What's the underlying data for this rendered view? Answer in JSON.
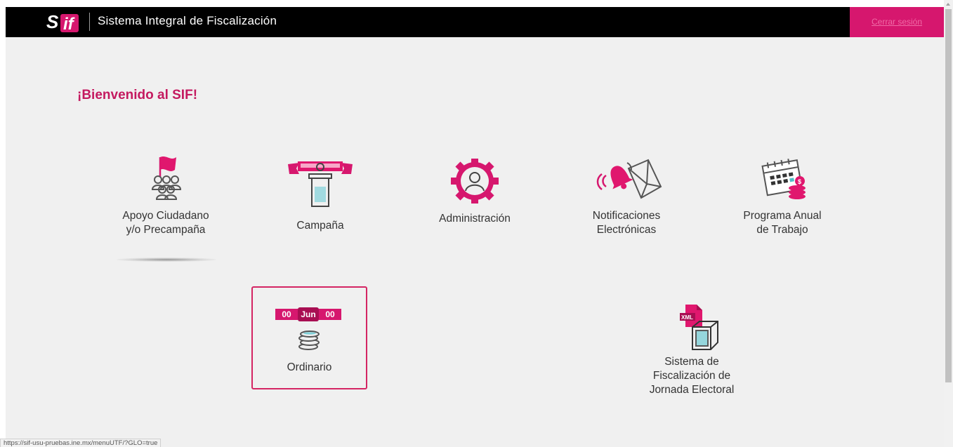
{
  "header": {
    "logo_text": "Sif",
    "title": "Sistema Integral de Fiscalización",
    "logout_label": "Cerrar sesión",
    "brand_color": "#d6176e"
  },
  "welcome": "¡Bienvenido al SIF!",
  "modules": {
    "apoyo": {
      "label_line1": "Apoyo Ciudadano",
      "label_line2": "y/o Precampaña",
      "icon": "flag-people-icon"
    },
    "campana": {
      "label": "Campaña",
      "icon": "podium-banner-icon"
    },
    "admin": {
      "label": "Administración",
      "icon": "gear-user-icon"
    },
    "notif": {
      "label_line1": "Notificaciones",
      "label_line2": "Electrónicas",
      "icon": "bell-envelope-icon"
    },
    "programa": {
      "label_line1": "Programa Anual",
      "label_line2": "de Trabajo",
      "icon": "calendar-coins-icon"
    },
    "ordinario": {
      "label": "Ordinario",
      "date_day": "00",
      "date_month": "Jun",
      "date_year": "00",
      "icon": "coins-stack-icon"
    },
    "jornada": {
      "label_line1": "Sistema de",
      "label_line2": "Fiscalización de",
      "label_line3": "Jornada Electoral",
      "icon": "xml-box-icon",
      "xml_text": "XML"
    }
  },
  "status_bar": {
    "url": "https://sif-usu-pruebas.ine.mx/menuUTF/?GLO=true"
  }
}
